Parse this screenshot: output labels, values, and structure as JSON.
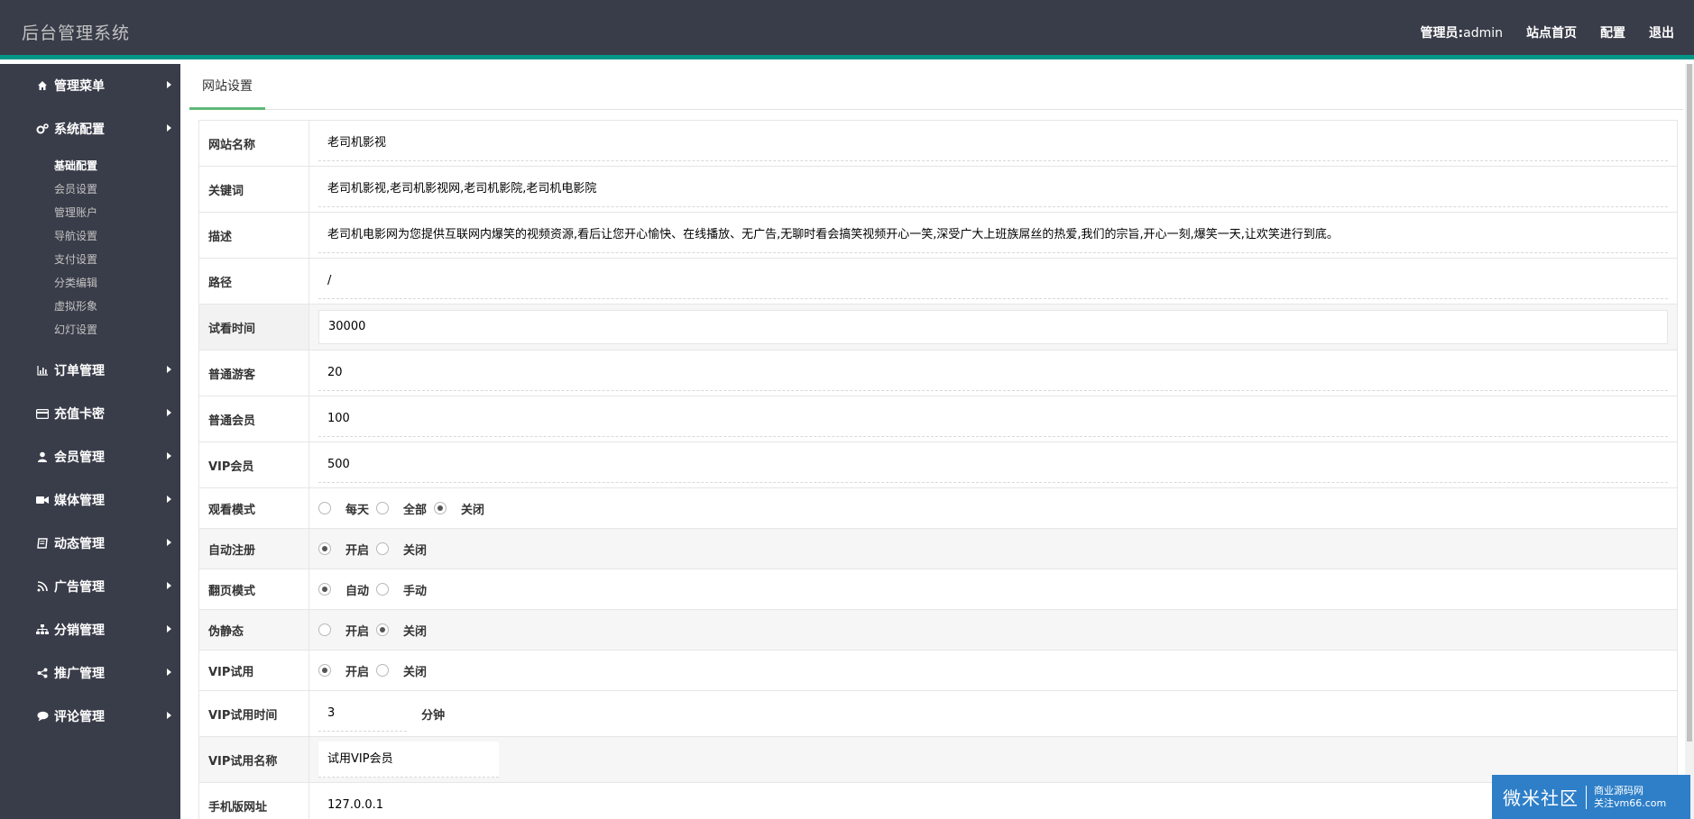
{
  "header": {
    "brand": "后台管理系统",
    "admin_label": "管理员:",
    "admin_name": "admin",
    "home_link": "站点首页",
    "config_link": "配置",
    "logout_link": "退出",
    "accent_color": "#009688"
  },
  "sidebar": {
    "items": [
      {
        "label": "管理菜单",
        "icon": "home-icon"
      },
      {
        "label": "系统配置",
        "icon": "cogs-icon"
      },
      {
        "label": "订单管理",
        "icon": "bar-chart-icon"
      },
      {
        "label": "充值卡密",
        "icon": "credit-card-icon"
      },
      {
        "label": "会员管理",
        "icon": "user-icon"
      },
      {
        "label": "媒体管理",
        "icon": "video-icon"
      },
      {
        "label": "动态管理",
        "icon": "book-icon"
      },
      {
        "label": "广告管理",
        "icon": "rss-icon"
      },
      {
        "label": "分销管理",
        "icon": "sitemap-icon"
      },
      {
        "label": "推广管理",
        "icon": "share-icon"
      },
      {
        "label": "评论管理",
        "icon": "comment-icon"
      }
    ],
    "submenu": [
      {
        "label": "基础配置",
        "active": true
      },
      {
        "label": "会员设置"
      },
      {
        "label": "管理账户"
      },
      {
        "label": "导航设置"
      },
      {
        "label": "支付设置"
      },
      {
        "label": "分类编辑"
      },
      {
        "label": "虚拟形象"
      },
      {
        "label": "幻灯设置"
      }
    ]
  },
  "main": {
    "tab": "网站设置",
    "tab_accent": "#5fb878",
    "fields": {
      "site_name": {
        "label": "网站名称",
        "value": "老司机影视"
      },
      "keywords": {
        "label": "关键词",
        "value": "老司机影视,老司机影视网,老司机影院,老司机电影院"
      },
      "description": {
        "label": "描述",
        "value": "老司机电影网为您提供互联网内爆笑的视频资源,看后让您开心愉快、在线播放、无广告,无聊时看会搞笑视频开心一笑,深受广大上班族屌丝的热爱,我们的宗旨,开心一刻,爆笑一天,让欢笑进行到底。"
      },
      "path": {
        "label": "路径",
        "value": "/"
      },
      "trial_time": {
        "label": "试看时间",
        "value": "30000"
      },
      "guest": {
        "label": "普通游客",
        "value": "20"
      },
      "member": {
        "label": "普通会员",
        "value": "100"
      },
      "vip": {
        "label": "VIP会员",
        "value": "500"
      },
      "watch_mode": {
        "label": "观看模式",
        "options": [
          "每天",
          "全部",
          "关闭"
        ],
        "selected": 2
      },
      "auto_register": {
        "label": "自动注册",
        "options": [
          "开启",
          "关闭"
        ],
        "selected": 0
      },
      "paging_mode": {
        "label": "翻页模式",
        "options": [
          "自动",
          "手动"
        ],
        "selected": 0
      },
      "pseudo_static": {
        "label": "伪静态",
        "options": [
          "开启",
          "关闭"
        ],
        "selected": 1
      },
      "vip_trial": {
        "label": "VIP试用",
        "options": [
          "开启",
          "关闭"
        ],
        "selected": 0
      },
      "vip_trial_time": {
        "label": "VIP试用时间",
        "value": "3",
        "unit": "分钟"
      },
      "vip_trial_name": {
        "label": "VIP试用名称",
        "value": "试用VIP会员"
      },
      "mobile_url": {
        "label": "手机版网址",
        "value": "127.0.0.1"
      }
    }
  },
  "watermark": {
    "big": "微米社区",
    "line1": "商业源码网",
    "line2": "关注vm66.com",
    "color": "#2e7fc8"
  }
}
